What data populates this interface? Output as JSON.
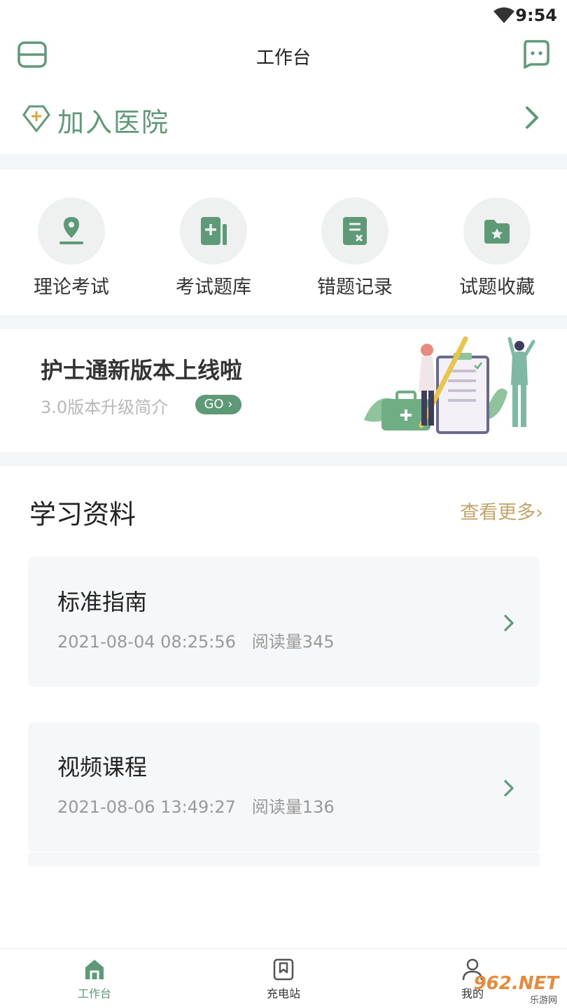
{
  "status_bar": {
    "time": "9:54"
  },
  "header": {
    "title": "工作台"
  },
  "join_hospital": {
    "label": "加入医院"
  },
  "quick_actions": [
    {
      "label": "理论考试",
      "icon": "pen-nib-icon"
    },
    {
      "label": "考试题库",
      "icon": "add-document-icon"
    },
    {
      "label": "错题记录",
      "icon": "error-list-icon"
    },
    {
      "label": "试题收藏",
      "icon": "star-folder-icon"
    }
  ],
  "banner": {
    "title": "护士通新版本上线啦",
    "subtitle": "3.0版本升级简介",
    "go_label": "GO ›"
  },
  "study": {
    "title": "学习资料",
    "more_label": "查看更多›",
    "items": [
      {
        "title": "标准指南",
        "date": "2021-08-04 08:25:56",
        "reads": "阅读量345"
      },
      {
        "title": "视频课程",
        "date": "2021-08-06 13:49:27",
        "reads": "阅读量136"
      }
    ]
  },
  "bottom_nav": {
    "items": [
      {
        "label": "工作台",
        "icon": "home-icon",
        "active": true
      },
      {
        "label": "充电站",
        "icon": "bookmark-icon",
        "active": false
      },
      {
        "label": "我的",
        "icon": "user-icon",
        "active": false
      }
    ]
  },
  "watermark": {
    "text": "962.NET",
    "sub": "乐游网"
  },
  "colors": {
    "brand": "#5e9a78",
    "more_link": "#c2a667",
    "background_gap": "#f4f5f6"
  }
}
